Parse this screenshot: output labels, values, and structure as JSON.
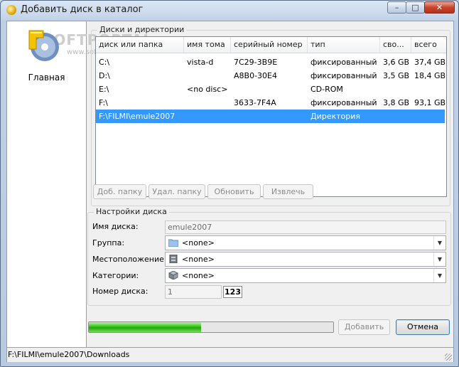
{
  "window": {
    "title": "Добавить диск в каталог"
  },
  "titlebar_buttons": {
    "minimize": "–",
    "maximize": "□",
    "close": "✕"
  },
  "sidebar": {
    "home_label": "Главная",
    "watermark": "SOFTPORTAL",
    "watermark_sub": "www.softportal.com"
  },
  "disks": {
    "group_title": "Диски и директории",
    "columns": [
      "диск или папка",
      "имя тома",
      "серийный номер",
      "тип",
      "сво...",
      "всего"
    ],
    "rows": [
      {
        "path": "C:\\",
        "volume": "vista-d",
        "serial": "7C29-3B9E",
        "type": "фиксированный",
        "free": "3,6 GB",
        "total": "37,4 GB",
        "selected": false
      },
      {
        "path": "D:\\",
        "volume": "",
        "serial": "A8B0-30E4",
        "type": "фиксированный",
        "free": "3,5 GB",
        "total": "18,4 GB",
        "selected": false
      },
      {
        "path": "E:\\",
        "volume": "<no disc>",
        "serial": "",
        "type": "CD-ROM",
        "free": "",
        "total": "",
        "selected": false
      },
      {
        "path": "F:\\",
        "volume": "",
        "serial": "3633-7F4A",
        "type": "фиксированный",
        "free": "3,8 GB",
        "total": "93,1 GB",
        "selected": false
      },
      {
        "path": "F:\\FILMI\\emule2007",
        "volume": "",
        "serial": "",
        "type": "Директория",
        "free": "",
        "total": "",
        "selected": true
      }
    ],
    "buttons": {
      "add_folder": "Доб. папку",
      "remove_folder": "Удал. папку",
      "refresh": "Обновить",
      "eject": "Извлечь"
    }
  },
  "settings": {
    "group_title": "Настройки диска",
    "disk_name_label": "Имя диска:",
    "disk_name_value": "emule2007",
    "group_label": "Группа:",
    "group_value": "<none>",
    "location_label": "Местоположение:",
    "location_value": "<none>",
    "categories_label": "Категории:",
    "categories_value": "<none>",
    "disk_number_label": "Номер диска:",
    "disk_number_value": "1",
    "disk_number_badge": "123"
  },
  "progress": {
    "percent": 46
  },
  "actions": {
    "add": "Добавить",
    "cancel": "Отмена"
  },
  "status": {
    "path": "F:\\FILMI\\emule2007\\Downloads"
  },
  "colors": {
    "selection": "#3399ff",
    "progress": "#34c518"
  }
}
